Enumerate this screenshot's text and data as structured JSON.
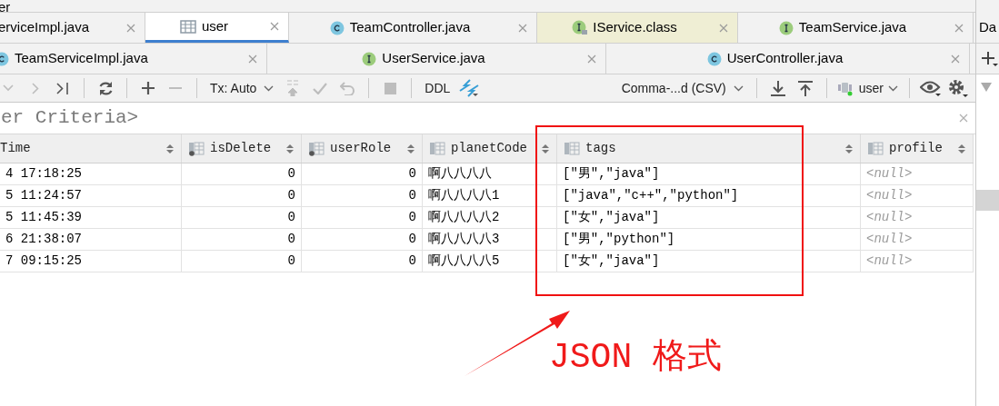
{
  "title_fragment": "er",
  "tab_rows": [
    [
      {
        "label": "erviceImpl.java",
        "kind": "plain",
        "selected": false,
        "highlighted": false
      },
      {
        "label": "user",
        "kind": "table",
        "selected": true,
        "highlighted": false
      },
      {
        "label": "TeamController.java",
        "kind": "class",
        "selected": false,
        "highlighted": false
      },
      {
        "label": "IService.class",
        "kind": "compiled",
        "selected": false,
        "highlighted": true
      },
      {
        "label": "TeamService.java",
        "kind": "interface",
        "selected": false,
        "highlighted": false
      }
    ],
    [
      {
        "label": "TeamServiceImpl.java",
        "kind": "class",
        "selected": false,
        "highlighted": false
      },
      {
        "label": "UserService.java",
        "kind": "interface",
        "selected": false,
        "highlighted": false
      },
      {
        "label": "UserController.java",
        "kind": "class",
        "selected": false,
        "highlighted": false
      }
    ]
  ],
  "toolbar": {
    "left": [
      {
        "kind": "collapse",
        "disabled": true
      },
      {
        "kind": "next",
        "disabled": true
      },
      {
        "kind": "last",
        "disabled": false
      },
      {
        "kind": "separator"
      },
      {
        "kind": "refresh",
        "disabled": false
      },
      {
        "kind": "separator"
      },
      {
        "kind": "add",
        "disabled": false
      },
      {
        "kind": "remove",
        "disabled": true
      },
      {
        "kind": "separator"
      },
      {
        "kind": "dropdown",
        "label": "Tx: Auto"
      },
      {
        "kind": "submit",
        "disabled": true
      },
      {
        "kind": "commit",
        "disabled": true
      },
      {
        "kind": "rollback",
        "disabled": true
      },
      {
        "kind": "separator"
      },
      {
        "kind": "stop",
        "disabled": true
      },
      {
        "kind": "separator"
      },
      {
        "kind": "ddl",
        "label": "DDL"
      },
      {
        "kind": "compare",
        "disabled": false
      }
    ],
    "right": [
      {
        "kind": "dropdown",
        "label": "Comma-...d (CSV)"
      },
      {
        "kind": "separator"
      },
      {
        "kind": "download",
        "disabled": false
      },
      {
        "kind": "upload",
        "disabled": false
      },
      {
        "kind": "separator"
      },
      {
        "kind": "datasource",
        "label": "user"
      },
      {
        "kind": "separator"
      },
      {
        "kind": "view",
        "disabled": false
      },
      {
        "kind": "settings",
        "disabled": false
      }
    ]
  },
  "filter": {
    "text": "er Criteria>"
  },
  "table": {
    "columns": [
      {
        "label": "Time"
      },
      {
        "label": "isDelete"
      },
      {
        "label": "userRole"
      },
      {
        "label": "planetCode"
      },
      {
        "label": "tags"
      },
      {
        "label": "profile"
      }
    ],
    "rows": [
      [
        "4 17:18:25",
        "0",
        "0",
        "啊八八八八",
        "[\"男\",\"java\"]",
        {
          "text": "<null>",
          "null": true
        }
      ],
      [
        "5 11:24:57",
        "0",
        "0",
        "啊八八八八1",
        "[\"java\",\"c++\",\"python\"]",
        {
          "text": "<null>",
          "null": true
        }
      ],
      [
        "5 11:45:39",
        "0",
        "0",
        "啊八八八八2",
        "[\"女\",\"java\"]",
        {
          "text": "<null>",
          "null": true
        }
      ],
      [
        "6 21:38:07",
        "0",
        "0",
        "啊八八八八3",
        "[\"男\",\"python\"]",
        {
          "text": "<null>",
          "null": true
        }
      ],
      [
        "7 09:15:25",
        "0",
        "0",
        "啊八八八八5",
        "[\"女\",\"java\"]",
        {
          "text": "<null>",
          "null": true
        }
      ]
    ]
  },
  "side_panel": {
    "tab": "Da"
  },
  "annotation": {
    "label": "JSON 格式"
  }
}
